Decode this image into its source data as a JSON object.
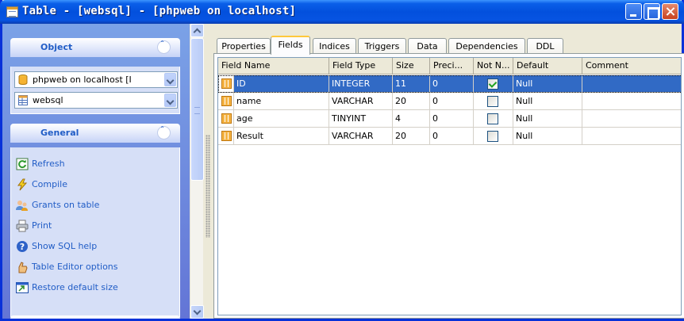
{
  "window": {
    "title": "Table - [websql] - [phpweb on localhost]"
  },
  "sidebar": {
    "object_panel": {
      "title": "Object",
      "connection": "phpweb on localhost [I",
      "table": "websql"
    },
    "general_panel": {
      "title": "General",
      "links": [
        {
          "label": "Refresh",
          "icon": "refresh-icon"
        },
        {
          "label": "Compile",
          "icon": "compile-icon"
        },
        {
          "label": "Grants on table",
          "icon": "grants-icon"
        },
        {
          "label": "Print",
          "icon": "printer-icon"
        },
        {
          "label": "Show SQL help",
          "icon": "help-icon"
        },
        {
          "label": "Table Editor options",
          "icon": "options-icon"
        },
        {
          "label": "Restore default size",
          "icon": "restore-size-icon"
        }
      ]
    }
  },
  "tabs": [
    {
      "label": "Properties",
      "active": false
    },
    {
      "label": "Fields",
      "active": true
    },
    {
      "label": "Indices",
      "active": false
    },
    {
      "label": "Triggers",
      "active": false
    },
    {
      "label": "Data",
      "active": false
    },
    {
      "label": "Dependencies",
      "active": false
    },
    {
      "label": "DDL",
      "active": false
    }
  ],
  "grid": {
    "columns": [
      "Field Name",
      "Field Type",
      "Size",
      "Preci...",
      "Not N...",
      "Default",
      "Comment"
    ],
    "rows": [
      {
        "name": "ID",
        "type": "INTEGER",
        "size": "11",
        "precision": "0",
        "not_null": true,
        "default": "Null",
        "comment": "",
        "selected": true
      },
      {
        "name": "name",
        "type": "VARCHAR",
        "size": "20",
        "precision": "0",
        "not_null": false,
        "default": "Null",
        "comment": "",
        "selected": false
      },
      {
        "name": "age",
        "type": "TINYINT",
        "size": "4",
        "precision": "0",
        "not_null": false,
        "default": "Null",
        "comment": "",
        "selected": false
      },
      {
        "name": "Result",
        "type": "VARCHAR",
        "size": "20",
        "precision": "0",
        "not_null": false,
        "default": "Null",
        "comment": "",
        "selected": false
      }
    ]
  }
}
